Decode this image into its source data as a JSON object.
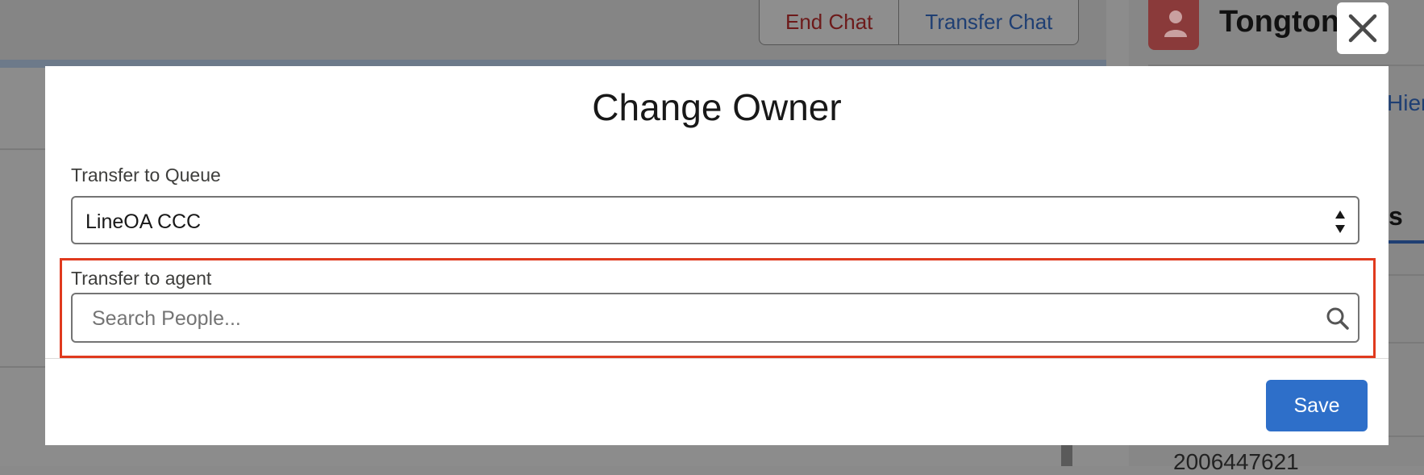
{
  "background": {
    "chat_actions": {
      "end_chat": "End Chat",
      "transfer_chat": "Transfer Chat"
    },
    "contact_name": "Tongtong",
    "hier_fragment": "Hier",
    "tab_fragment": "s",
    "number_fragment": "2006447621"
  },
  "modal": {
    "title": "Change Owner",
    "queue_label": "Transfer to Queue",
    "queue_value": "LineOA CCC",
    "agent_label": "Transfer to agent",
    "agent_placeholder": "Search People...",
    "save_label": "Save"
  },
  "colors": {
    "primary": "#2e6fc9",
    "highlight": "#e03a1e"
  },
  "icons": {
    "close": "close-icon",
    "search": "search-icon",
    "select_arrows": "select-arrows-icon",
    "contact": "contact-icon"
  }
}
